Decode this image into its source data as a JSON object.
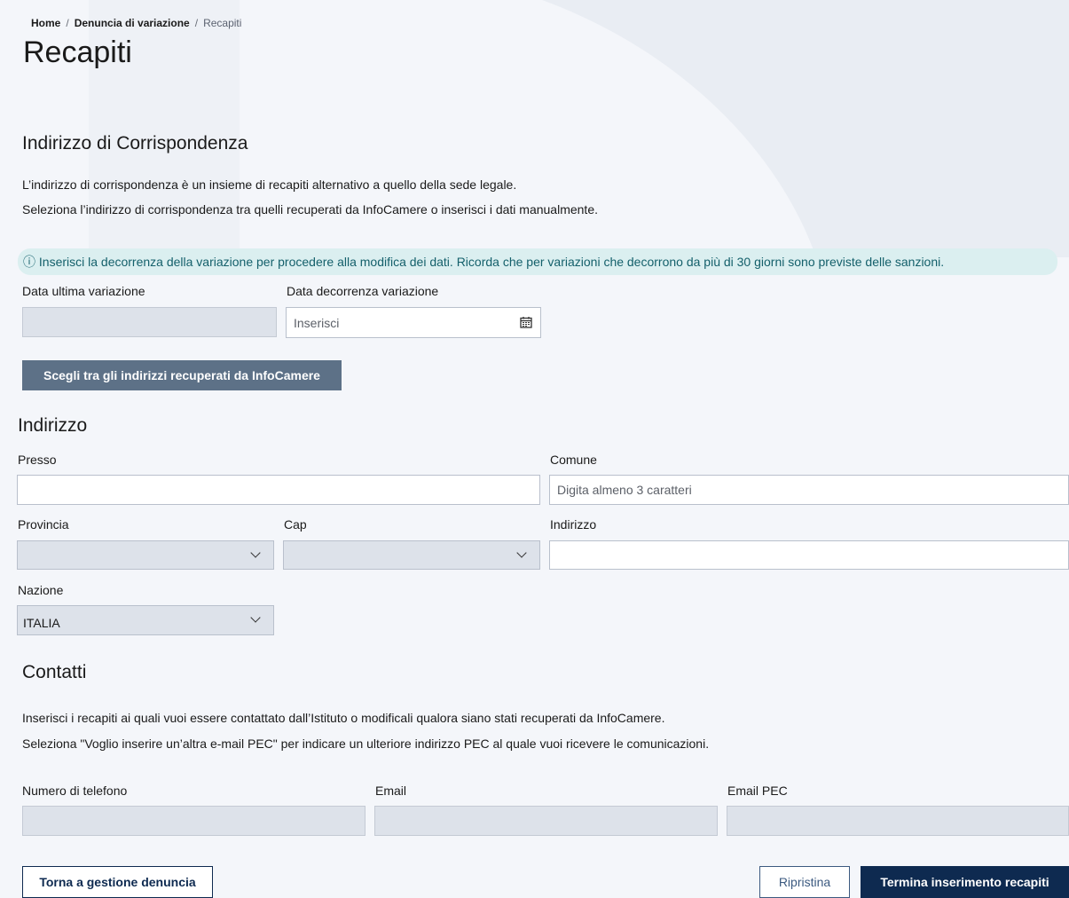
{
  "breadcrumb": {
    "home": "Home",
    "separator": "/",
    "parent": "Denuncia di variazione",
    "current": "Recapiti"
  },
  "page_title": "Recapiti",
  "correspondence": {
    "title": "Indirizzo di Corrispondenza",
    "line1": "L’indirizzo di corrispondenza è un insieme di recapiti alternativo a quello della sede legale.",
    "line2": "Seleziona l’indirizzo di corrispondenza tra quelli recuperati da InfoCamere o inserisci i dati manualmente."
  },
  "info_message": {
    "icon": "info-circle-icon",
    "text": "ⓘ Inserisci la decorrenza della variazione per procedere alla modifica dei dati. Ricorda che per variazioni che decorrono da più di 30 giorni sono previste delle sanzioni."
  },
  "dates": {
    "last_label": "Data ultima variazione",
    "last_value": "",
    "effective_label": "Data decorrenza variazione",
    "effective_placeholder": "Inserisci",
    "calendar_icon": "calendar-icon"
  },
  "infocamere_button": "Scegli tra gli indirizzi recuperati da InfoCamere",
  "address": {
    "title": "Indirizzo",
    "presso_label": "Presso",
    "presso_value": "",
    "comune_label": "Comune",
    "comune_placeholder": "Digita almeno 3 caratteri",
    "provincia_label": "Provincia",
    "provincia_value": "",
    "cap_label": "Cap",
    "cap_value": "",
    "indirizzo_label": "Indirizzo",
    "indirizzo_value": "",
    "nazione_label": "Nazione",
    "nazione_value": "ITALIA"
  },
  "contacts": {
    "title": "Contatti",
    "line1": "Inserisci i recapiti ai quali vuoi essere contattato dall’Istituto o modificali qualora siano stati recuperati da InfoCamere.",
    "line2": "Seleziona \"Voglio inserire un’altra e-mail PEC\" per indicare un ulteriore indirizzo PEC al quale vuoi ricevere le comunicazioni.",
    "phone_label": "Numero di telefono",
    "email_label": "Email",
    "pec_label": "Email PEC"
  },
  "footer": {
    "back_button": "Torna a gestione denuncia",
    "reset_button": "Ripristina",
    "finish_button": "Termina inserimento recapiti"
  },
  "colors": {
    "background": "#f4f6fa",
    "info_bg": "#dbeff0",
    "info_text": "#14606b",
    "primary": "#0e2a50",
    "secondary_button": "#5d7187",
    "disabled_field": "#dde2ea"
  }
}
